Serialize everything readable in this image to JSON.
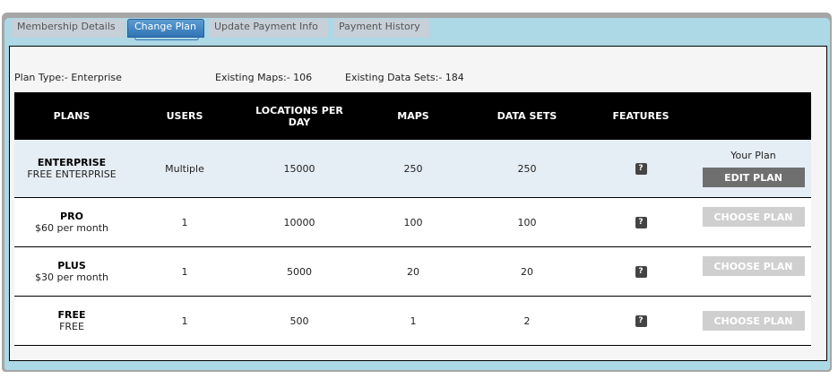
{
  "tabs": [
    {
      "label": "Membership Details"
    },
    {
      "label": "Change Plan"
    },
    {
      "label": "Update Payment Info"
    },
    {
      "label": "Payment History"
    }
  ],
  "summary": {
    "plan_type": "Plan Type:- Enterprise",
    "existing_maps": "Existing Maps:- 106",
    "existing_data_sets": "Existing Data Sets:- 184"
  },
  "table": {
    "headers": {
      "plans": "PLANS",
      "users": "USERS",
      "locations_line1": "LOCATIONS PER",
      "locations_line2": "DAY",
      "maps": "MAPS",
      "data_sets": "DATA SETS",
      "features": "FEATURES"
    },
    "rows": [
      {
        "name": "ENTERPRISE",
        "price": "FREE ENTERPRISE",
        "users": "Multiple",
        "locations": "15000",
        "maps": "250",
        "data_sets": "250",
        "features_icon": "?",
        "status": "Your Plan",
        "button": "EDIT PLAN"
      },
      {
        "name": "PRO",
        "price": "$60 per month",
        "users": "1",
        "locations": "10000",
        "maps": "100",
        "data_sets": "100",
        "features_icon": "?",
        "button": "CHOOSE PLAN"
      },
      {
        "name": "PLUS",
        "price": "$30 per month",
        "users": "1",
        "locations": "5000",
        "maps": "20",
        "data_sets": "20",
        "features_icon": "?",
        "button": "CHOOSE PLAN"
      },
      {
        "name": "FREE",
        "price": "FREE",
        "users": "1",
        "locations": "500",
        "maps": "1",
        "data_sets": "2",
        "features_icon": "?",
        "button": "CHOOSE PLAN"
      }
    ]
  },
  "colors": {
    "panel_bg": "#add8e6",
    "active_tab": "#3a82c4",
    "header_bg": "#000000",
    "current_row_bg": "#e6eef5",
    "edit_button": "#6f6f6f",
    "choose_button": "#cfcfcf"
  }
}
